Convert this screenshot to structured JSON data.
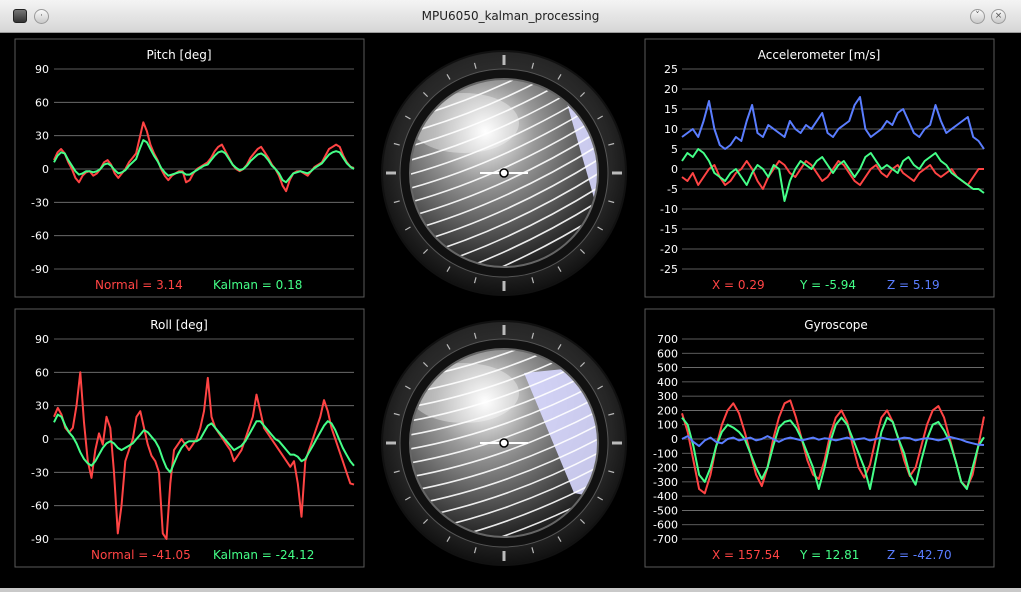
{
  "window": {
    "title": "MPU6050_kalman_processing"
  },
  "pitch": {
    "title": "Pitch [deg]",
    "ticks": [
      "90",
      "60",
      "30",
      "0",
      "-30",
      "-60",
      "-90"
    ],
    "legend_normal": "Normal = 3.14",
    "legend_kalman": "Kalman = 0.18"
  },
  "roll": {
    "title": "Roll [deg]",
    "ticks": [
      "90",
      "60",
      "30",
      "0",
      "-30",
      "-60",
      "-90"
    ],
    "legend_normal": "Normal = -41.05",
    "legend_kalman": "Kalman = -24.12"
  },
  "accel": {
    "title": "Accelerometer [m/s]",
    "ticks": [
      "25",
      "20",
      "15",
      "10",
      "5",
      "0",
      "-5",
      "-10",
      "-15",
      "-20",
      "-25"
    ],
    "legend_x": "X = 0.29",
    "legend_y": "Y = -5.94",
    "legend_z": "Z = 5.19"
  },
  "gyro": {
    "title": "Gyroscope",
    "ticks": [
      "700",
      "600",
      "500",
      "400",
      "300",
      "200",
      "100",
      "0",
      "-100",
      "-200",
      "-300",
      "-400",
      "-500",
      "-600",
      "-700"
    ],
    "legend_x": "X = 157.54",
    "legend_y": "Y = 12.81",
    "legend_z": "Z = -42.70"
  },
  "colors": {
    "normal": "#ff4444",
    "kalman": "#44ff88",
    "z": "#5a7dff",
    "frame": "#5a5a5a",
    "grid": "#7a7a7a"
  },
  "chart_data": [
    {
      "type": "line",
      "title": "Pitch [deg]",
      "ylim": [
        -90,
        90
      ],
      "series": [
        {
          "name": "Normal",
          "values": [
            8,
            15,
            18,
            14,
            6,
            0,
            -8,
            -12,
            -6,
            -3,
            -2,
            -6,
            -4,
            0,
            6,
            8,
            4,
            -4,
            -8,
            -4,
            0,
            6,
            10,
            14,
            28,
            42,
            34,
            22,
            14,
            8,
            0,
            -6,
            -10,
            -6,
            -4,
            -2,
            -2,
            -12,
            -10,
            -4,
            0,
            2,
            4,
            6,
            10,
            16,
            20,
            22,
            16,
            10,
            4,
            0,
            -2,
            0,
            4,
            10,
            14,
            18,
            20,
            15,
            10,
            4,
            0,
            -6,
            -15,
            -20,
            -10,
            -4,
            -2,
            -2,
            -4,
            -6,
            -2,
            2,
            4,
            6,
            12,
            18,
            20,
            22,
            20,
            12,
            6,
            2,
            1
          ]
        },
        {
          "name": "Kalman",
          "values": [
            6,
            12,
            15,
            14,
            8,
            3,
            -2,
            -5,
            -4,
            -2,
            -2,
            -3,
            -2,
            0,
            4,
            5,
            3,
            -1,
            -4,
            -3,
            -1,
            3,
            6,
            9,
            18,
            26,
            24,
            18,
            12,
            7,
            1,
            -3,
            -6,
            -5,
            -4,
            -3,
            -3,
            -5,
            -5,
            -3,
            -1,
            1,
            3,
            4,
            8,
            12,
            15,
            16,
            14,
            9,
            4,
            1,
            -1,
            0,
            3,
            7,
            10,
            13,
            14,
            12,
            8,
            3,
            0,
            -4,
            -10,
            -12,
            -8,
            -4,
            -3,
            -2,
            -3,
            -4,
            -2,
            1,
            3,
            5,
            9,
            13,
            15,
            16,
            15,
            10,
            5,
            2,
            0
          ]
        }
      ]
    },
    {
      "type": "line",
      "title": "Roll [deg]",
      "ylim": [
        -90,
        90
      ],
      "series": [
        {
          "name": "Normal",
          "values": [
            20,
            28,
            22,
            10,
            6,
            10,
            30,
            60,
            15,
            -20,
            -35,
            -10,
            5,
            -5,
            20,
            10,
            -30,
            -85,
            -60,
            -20,
            -10,
            0,
            20,
            25,
            10,
            -5,
            -15,
            -20,
            -30,
            -85,
            -90,
            -40,
            -10,
            -5,
            0,
            -5,
            -10,
            -5,
            0,
            10,
            25,
            55,
            20,
            10,
            5,
            0,
            -5,
            -10,
            -20,
            -15,
            -10,
            0,
            10,
            20,
            40,
            25,
            10,
            5,
            0,
            -5,
            -10,
            -15,
            -20,
            -25,
            -20,
            -40,
            -70,
            -20,
            -10,
            0,
            10,
            20,
            35,
            25,
            10,
            0,
            -10,
            -20,
            -30,
            -40,
            -41
          ]
        },
        {
          "name": "Kalman",
          "values": [
            15,
            22,
            20,
            12,
            6,
            2,
            -4,
            -12,
            -18,
            -22,
            -24,
            -20,
            -14,
            -8,
            -4,
            -2,
            -4,
            -8,
            -10,
            -8,
            -6,
            -4,
            0,
            4,
            8,
            6,
            2,
            -2,
            -8,
            -18,
            -26,
            -30,
            -22,
            -14,
            -8,
            -4,
            -2,
            -2,
            -2,
            0,
            6,
            12,
            14,
            10,
            6,
            2,
            -2,
            -6,
            -10,
            -8,
            -6,
            -2,
            4,
            10,
            16,
            16,
            12,
            8,
            4,
            0,
            -2,
            -6,
            -10,
            -14,
            -14,
            -16,
            -20,
            -18,
            -12,
            -6,
            0,
            6,
            12,
            16,
            14,
            8,
            0,
            -8,
            -14,
            -20,
            -24
          ]
        }
      ]
    },
    {
      "type": "line",
      "title": "Accelerometer [m/s]",
      "ylim": [
        -25,
        25
      ],
      "series": [
        {
          "name": "X",
          "values": [
            -2,
            -3,
            -1,
            -4,
            -2,
            0,
            1,
            -2,
            -4,
            -3,
            -1,
            0,
            2,
            0,
            -3,
            -5,
            -2,
            0,
            2,
            1,
            -1,
            -2,
            0,
            2,
            1,
            -1,
            -3,
            -2,
            0,
            2,
            1,
            -1,
            -3,
            -4,
            -2,
            0,
            1,
            -1,
            -2,
            0,
            1,
            -1,
            -2,
            -3,
            -1,
            0,
            1,
            -1,
            -2,
            -1,
            0,
            -2,
            -3,
            -4,
            -2,
            0,
            0
          ]
        },
        {
          "name": "Y",
          "values": [
            2,
            4,
            3,
            5,
            4,
            2,
            -1,
            -2,
            -3,
            -1,
            0,
            -2,
            -4,
            -1,
            1,
            0,
            -2,
            1,
            0,
            -8,
            -3,
            0,
            2,
            1,
            0,
            2,
            3,
            1,
            -1,
            1,
            2,
            0,
            -2,
            0,
            3,
            4,
            2,
            0,
            1,
            0,
            -1,
            2,
            3,
            1,
            0,
            2,
            3,
            4,
            2,
            1,
            -1,
            -2,
            -3,
            -4,
            -5,
            -5,
            -6
          ]
        },
        {
          "name": "Z",
          "values": [
            8,
            9,
            10,
            8,
            12,
            17,
            10,
            6,
            5,
            6,
            8,
            7,
            12,
            16,
            9,
            8,
            11,
            10,
            9,
            8,
            12,
            10,
            9,
            11,
            10,
            12,
            14,
            9,
            8,
            10,
            11,
            12,
            16,
            18,
            10,
            8,
            9,
            10,
            12,
            11,
            14,
            15,
            12,
            9,
            8,
            10,
            11,
            16,
            12,
            9,
            10,
            11,
            12,
            13,
            8,
            7,
            5
          ]
        }
      ]
    },
    {
      "type": "line",
      "title": "Gyroscope",
      "ylim": [
        -700,
        700
      ],
      "series": [
        {
          "name": "X",
          "values": [
            180,
            50,
            -150,
            -350,
            -380,
            -250,
            -50,
            100,
            200,
            250,
            180,
            50,
            -100,
            -250,
            -330,
            -200,
            0,
            150,
            250,
            270,
            150,
            0,
            -150,
            -250,
            -280,
            -150,
            30,
            150,
            200,
            120,
            -50,
            -200,
            -270,
            -180,
            0,
            150,
            200,
            120,
            0,
            -150,
            -260,
            -200,
            -50,
            100,
            200,
            230,
            150,
            0,
            -150,
            -300,
            -340,
            -250,
            -50,
            157
          ]
        },
        {
          "name": "Y",
          "values": [
            150,
            100,
            -50,
            -250,
            -300,
            -200,
            -50,
            50,
            100,
            80,
            50,
            0,
            -100,
            -200,
            -280,
            -200,
            -50,
            80,
            120,
            130,
            80,
            0,
            -100,
            -200,
            -350,
            -200,
            -20,
            100,
            150,
            100,
            0,
            -100,
            -200,
            -350,
            -150,
            50,
            150,
            120,
            0,
            -100,
            -250,
            -320,
            -150,
            0,
            100,
            120,
            60,
            -20,
            -150,
            -300,
            -350,
            -200,
            -50,
            12
          ]
        },
        {
          "name": "Z",
          "values": [
            0,
            20,
            -20,
            -50,
            -10,
            10,
            -20,
            -30,
            0,
            10,
            -10,
            0,
            10,
            -10,
            0,
            20,
            0,
            -20,
            0,
            10,
            0,
            -10,
            0,
            10,
            -5,
            5,
            0,
            -10,
            0,
            10,
            -5,
            0,
            5,
            -10,
            0,
            10,
            0,
            -5,
            0,
            10,
            5,
            -10,
            0,
            5,
            0,
            -10,
            0,
            15,
            5,
            -5,
            -20,
            -30,
            -40,
            -42
          ]
        }
      ]
    }
  ]
}
